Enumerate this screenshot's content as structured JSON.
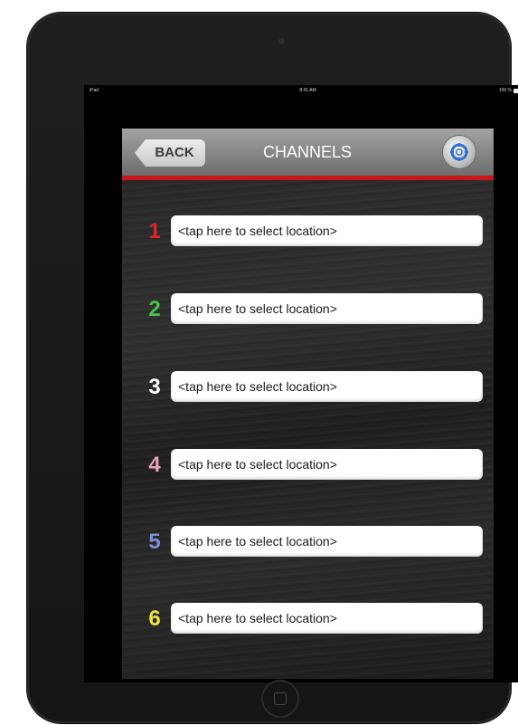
{
  "status_bar": {
    "carrier": "iPad",
    "time": "8:41 AM",
    "battery": "100 %"
  },
  "nav": {
    "back_label": "BACK",
    "title": "CHANNELS",
    "settings_icon": "refresh-gear-icon"
  },
  "colors": {
    "accent_bar": "#c8161b"
  },
  "channels": [
    {
      "number": "1",
      "color": "#e0242b",
      "placeholder": "<tap here to select location>"
    },
    {
      "number": "2",
      "color": "#4cc24a",
      "placeholder": "<tap here to select location>"
    },
    {
      "number": "3",
      "color": "#ffffff",
      "placeholder": "<tap here to select location>"
    },
    {
      "number": "4",
      "color": "#e9a0b4",
      "placeholder": "<tap here to select location>"
    },
    {
      "number": "5",
      "color": "#7f8fd6",
      "placeholder": "<tap here to select location>"
    },
    {
      "number": "6",
      "color": "#f3e23a",
      "placeholder": "<tap here to select location>"
    }
  ]
}
